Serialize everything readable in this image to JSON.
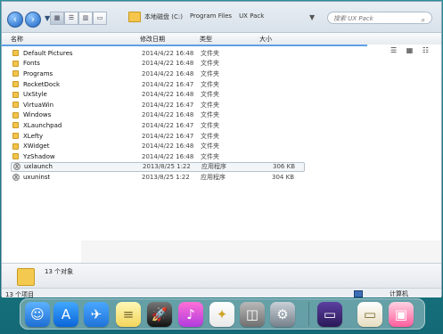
{
  "breadcrumb": [
    "本地磁盘 (C:)",
    "Program Files",
    "UX Pack"
  ],
  "search": {
    "placeholder": "搜索 UX Pack"
  },
  "columns": {
    "name": "名称",
    "date": "修改日期",
    "type": "类型",
    "size": "大小"
  },
  "files": [
    {
      "name": "Default Pictures",
      "date": "2014/4/22 16:48",
      "type": "文件夹",
      "size": "",
      "kind": "folder"
    },
    {
      "name": "Fonts",
      "date": "2014/4/22 16:48",
      "type": "文件夹",
      "size": "",
      "kind": "folder"
    },
    {
      "name": "Programs",
      "date": "2014/4/22 16:48",
      "type": "文件夹",
      "size": "",
      "kind": "folder"
    },
    {
      "name": "RocketDock",
      "date": "2014/4/22 16:47",
      "type": "文件夹",
      "size": "",
      "kind": "folder"
    },
    {
      "name": "UxStyle",
      "date": "2014/4/22 16:48",
      "type": "文件夹",
      "size": "",
      "kind": "folder"
    },
    {
      "name": "VirtuaWin",
      "date": "2014/4/22 16:47",
      "type": "文件夹",
      "size": "",
      "kind": "folder"
    },
    {
      "name": "Windows",
      "date": "2014/4/22 16:48",
      "type": "文件夹",
      "size": "",
      "kind": "folder"
    },
    {
      "name": "XLaunchpad",
      "date": "2014/4/22 16:47",
      "type": "文件夹",
      "size": "",
      "kind": "folder"
    },
    {
      "name": "XLefty",
      "date": "2014/4/22 16:47",
      "type": "文件夹",
      "size": "",
      "kind": "folder"
    },
    {
      "name": "XWidget",
      "date": "2014/4/22 16:48",
      "type": "文件夹",
      "size": "",
      "kind": "folder"
    },
    {
      "name": "YzShadow",
      "date": "2014/4/22 16:48",
      "type": "文件夹",
      "size": "",
      "kind": "folder"
    },
    {
      "name": "uxlaunch",
      "date": "2013/8/25 1:22",
      "type": "应用程序",
      "size": "306 KB",
      "kind": "app"
    },
    {
      "name": "uxuninst",
      "date": "2013/8/25 1:22",
      "type": "应用程序",
      "size": "304 KB",
      "kind": "app"
    }
  ],
  "status": {
    "object_count": "13 个对象",
    "item_count": "13 个项目",
    "computer": "计算机"
  },
  "dock": {
    "items": [
      "finder-icon",
      "app-store-icon",
      "safari-icon",
      "notes-icon",
      "rocket-icon",
      "itunes-icon",
      "photos-icon",
      "calculator-icon",
      "system-preferences-icon",
      "desktop-icon",
      "document-icon",
      "app-icon"
    ]
  }
}
